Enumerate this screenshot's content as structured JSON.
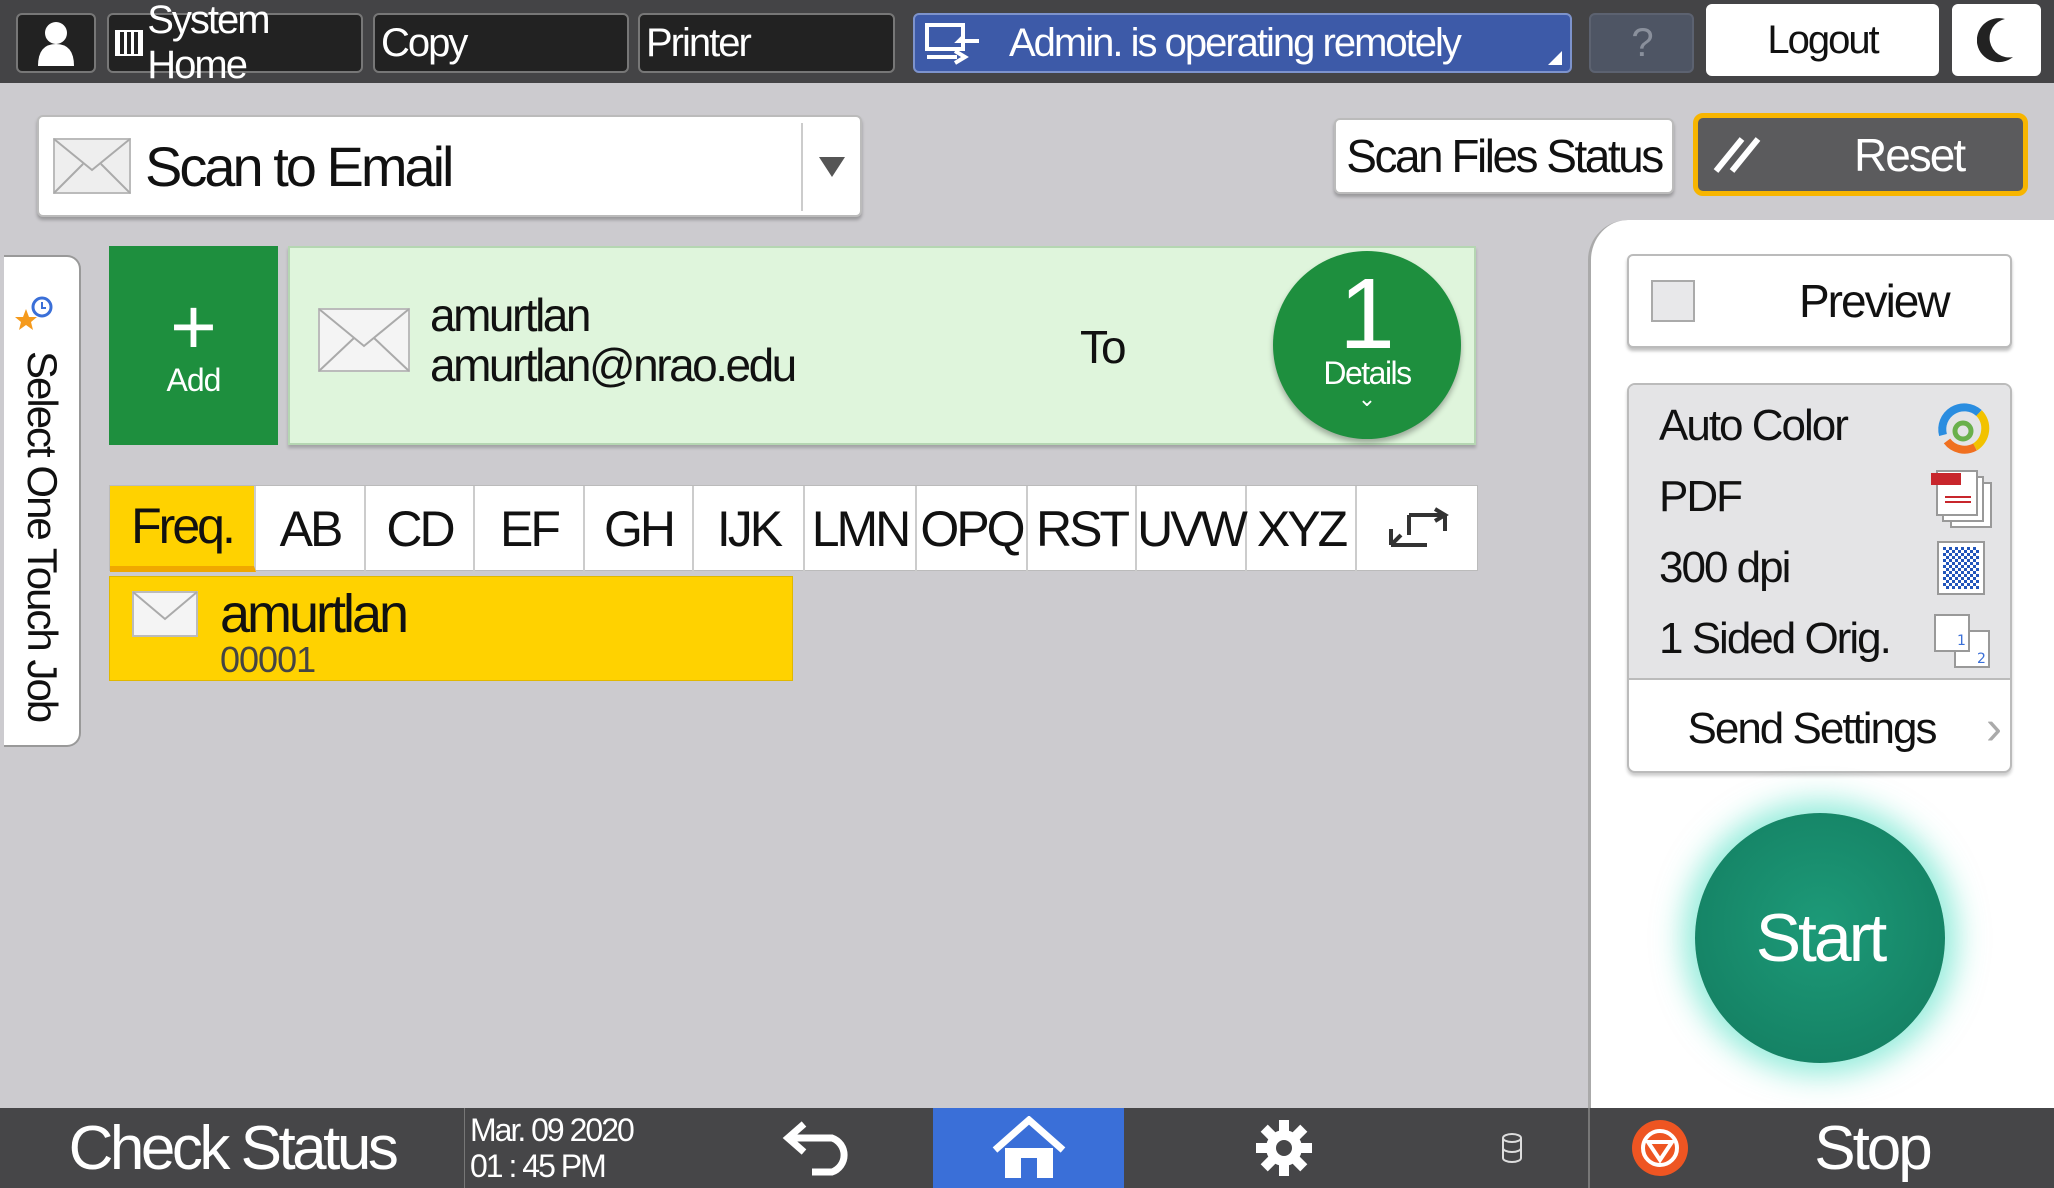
{
  "topbar": {
    "system_home": "System Home",
    "copy": "Copy",
    "printer": "Printer",
    "remote_status": "Admin. is operating remotely",
    "help": "?",
    "logout": "Logout"
  },
  "header": {
    "mode": "Scan to Email",
    "scan_files_status": "Scan Files Status",
    "reset": "Reset"
  },
  "side_tab": {
    "label": "Select One Touch Job"
  },
  "destination": {
    "add": "Add",
    "name": "amurtlan",
    "email": "amurtlan@nrao.edu",
    "type": "To",
    "count": "1",
    "details": "Details"
  },
  "index_tabs": [
    "Freq.",
    "AB",
    "CD",
    "EF",
    "GH",
    "IJK",
    "LMN",
    "OPQ",
    "RST",
    "UVW",
    "XYZ"
  ],
  "address_book": [
    {
      "name": "amurtlan",
      "number": "00001",
      "selected": true
    }
  ],
  "settings": {
    "preview": "Preview",
    "color": "Auto Color",
    "format": "PDF",
    "resolution": "300 dpi",
    "sides": "1 Sided Orig.",
    "send_settings": "Send Settings"
  },
  "start": "Start",
  "bottombar": {
    "check_status": "Check Status",
    "date": "Mar. 09 2020",
    "time": "01 : 45 PM",
    "stop": "Stop"
  },
  "colors": {
    "accent_green": "#1e8f3e",
    "start": "#16896a",
    "selected": "#ffd200",
    "remote_blue": "#3d5aa8",
    "home_blue": "#3a6fd8",
    "reset_border": "#f7b500",
    "stop": "#ee5522"
  }
}
